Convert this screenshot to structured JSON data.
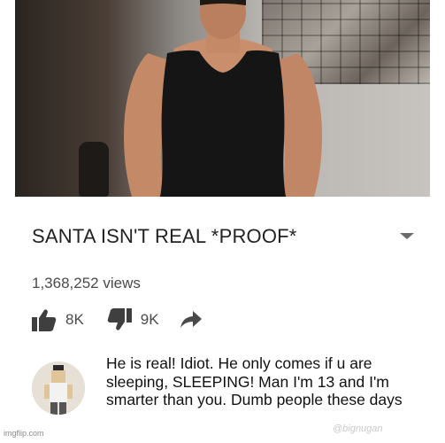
{
  "video": {
    "title": "SANTA ISN'T REAL *PROOF*",
    "views": "1,368,252 views"
  },
  "actions": {
    "likes": "8K",
    "dislikes": "9K"
  },
  "comment": {
    "text": "He is real! Idiot. He only comes if u are sleeping, SLEEPING! Man I'm 13 and I'm smarter than you. Dumb people these days"
  },
  "watermarks": {
    "left": "imgflip.com",
    "right": "@bignugan"
  },
  "icons": {
    "menu": "chevron-down-icon",
    "like": "thumbs-up-icon",
    "dislike": "thumbs-down-icon",
    "share": "share-arrow-icon"
  },
  "colors": {
    "text_primary": "#222222",
    "text_secondary": "#4a4a4a",
    "background": "#ffffff"
  }
}
